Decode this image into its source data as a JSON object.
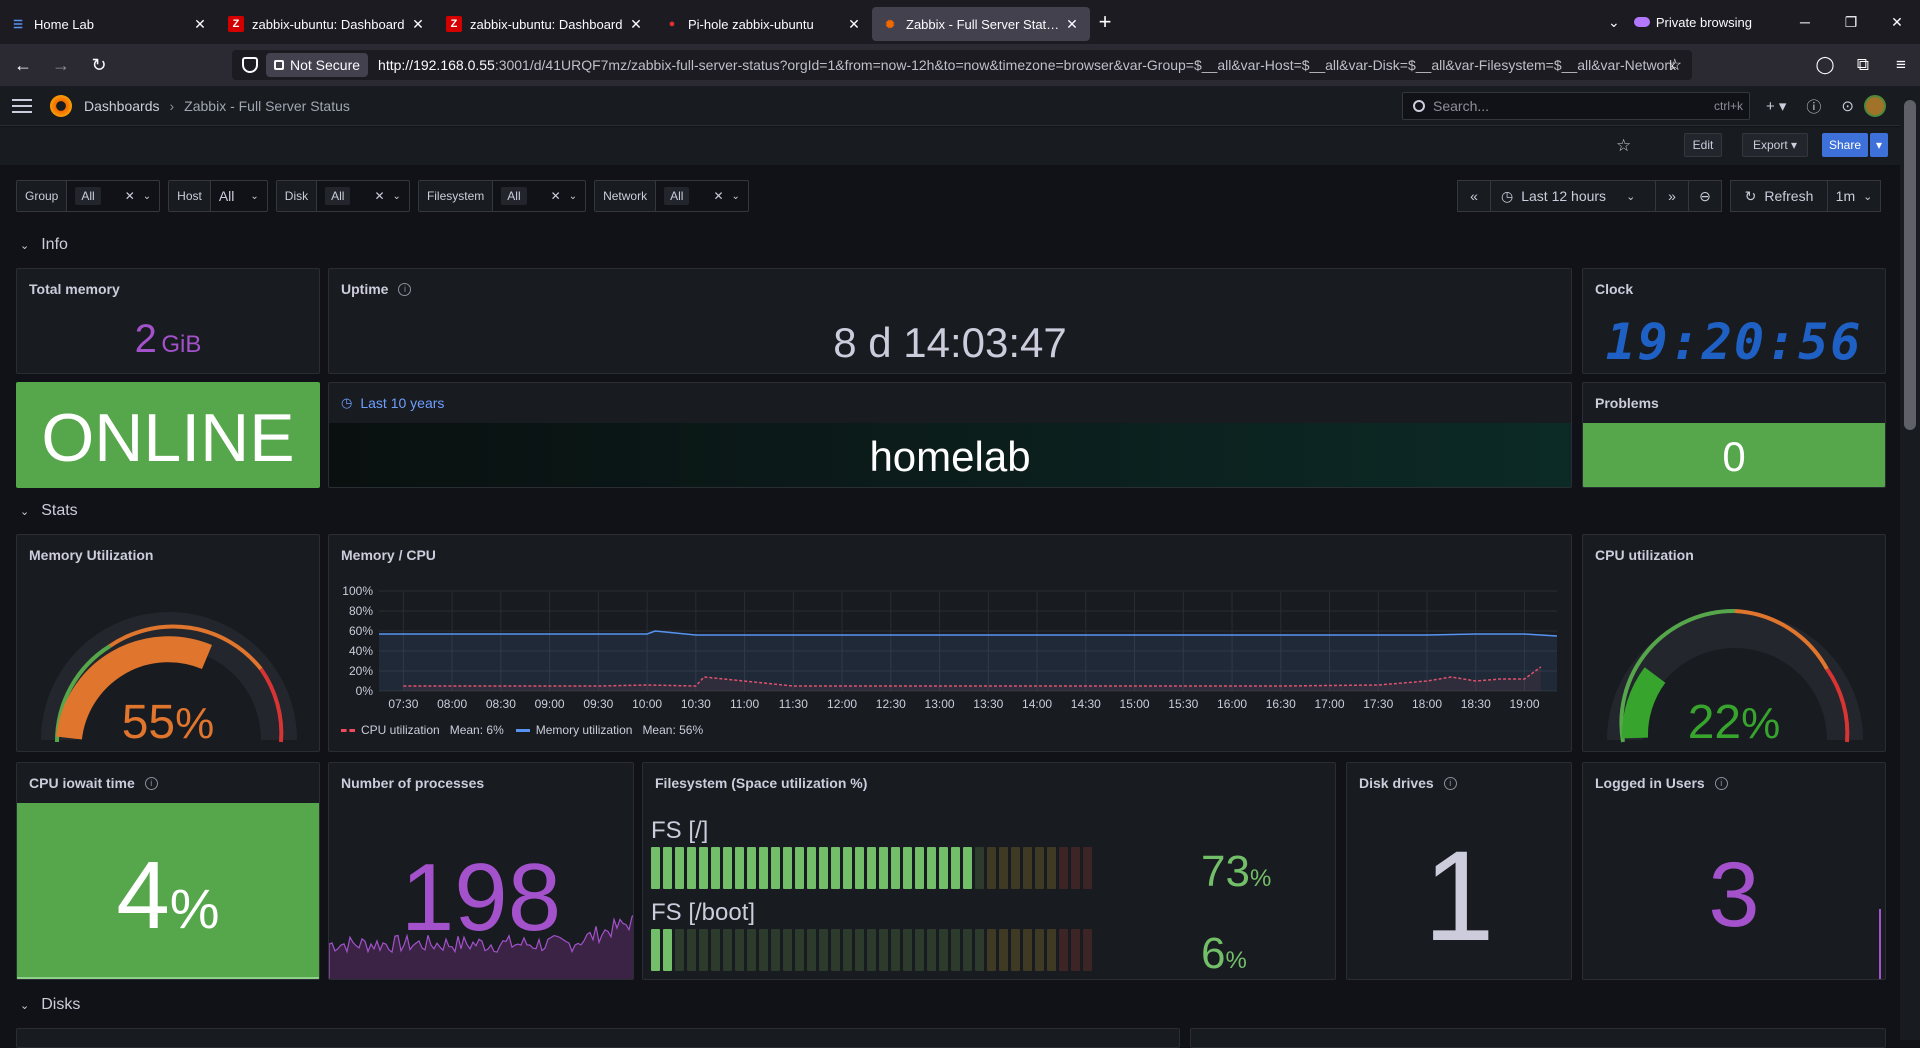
{
  "browser": {
    "tabs": [
      {
        "label": "Home Lab",
        "active": false,
        "icon": "homelab-icon"
      },
      {
        "label": "zabbix-ubuntu: Dashboard",
        "active": false,
        "icon": "zabbix-icon"
      },
      {
        "label": "zabbix-ubuntu: Dashboard",
        "active": false,
        "icon": "zabbix-icon"
      },
      {
        "label": "Pi-hole zabbix-ubuntu",
        "active": false,
        "icon": "pihole-icon"
      },
      {
        "label": "Zabbix - Full Server Status - Das",
        "active": true,
        "icon": "grafana-icon"
      }
    ],
    "private_label": "Private browsing",
    "not_secure": "Not Secure",
    "url_host": "http://192.168.0.55",
    "url_rest": ":3001/d/41URQF7mz/zabbix-full-server-status?orgId=1&from=now-12h&to=now&timezone=browser&var-Group=$__all&var-Host=$__all&var-Disk=$__all&var-Filesystem=$__all&var-Network"
  },
  "grafana": {
    "breadcrumb_root": "Dashboards",
    "breadcrumb_current": "Zabbix - Full Server Status",
    "search_placeholder": "Search...",
    "search_shortcut": "ctrl+k",
    "edit_label": "Edit",
    "export_label": "Export",
    "share_label": "Share",
    "variables": [
      {
        "label": "Group",
        "value": "All",
        "chip": true
      },
      {
        "label": "Host",
        "value": "All",
        "chip": false
      },
      {
        "label": "Disk",
        "value": "All",
        "chip": true
      },
      {
        "label": "Filesystem",
        "value": "All",
        "chip": true
      },
      {
        "label": "Network",
        "value": "All",
        "chip": true
      }
    ],
    "time_range": "Last 12 hours",
    "refresh_label": "Refresh",
    "refresh_interval": "1m"
  },
  "rows": {
    "info": "Info",
    "stats": "Stats",
    "disks": "Disks"
  },
  "panels": {
    "total_memory": {
      "title": "Total memory",
      "value": "2",
      "unit": "GiB"
    },
    "uptime": {
      "title": "Uptime",
      "value": "8 d 14:03:47"
    },
    "clock": {
      "title": "Clock",
      "value": "19:20:56"
    },
    "status": {
      "value": "ONLINE"
    },
    "hostname": {
      "time_override": "Last 10 years",
      "value": "homelab"
    },
    "problems": {
      "title": "Problems",
      "value": "0"
    },
    "memory_util": {
      "title": "Memory Utilization",
      "value": "55",
      "unit": "%"
    },
    "cpu_util": {
      "title": "CPU utilization",
      "value": "22",
      "unit": "%"
    },
    "memcpu": {
      "title": "Memory / CPU",
      "legend_cpu": "CPU utilization",
      "legend_cpu_mean": "Mean: 6%",
      "legend_mem": "Memory utilization",
      "legend_mem_mean": "Mean: 56%"
    },
    "iowait": {
      "title": "CPU iowait time",
      "value": "4",
      "unit": "%"
    },
    "processes": {
      "title": "Number of processes",
      "value": "198"
    },
    "filesystem": {
      "title": "Filesystem (Space utilization %)",
      "items": [
        {
          "name": "FS [/]",
          "value": "73",
          "unit": "%"
        },
        {
          "name": "FS [/boot]",
          "value": "6",
          "unit": "%"
        }
      ]
    },
    "disk_drives": {
      "title": "Disk drives",
      "value": "1"
    },
    "logged_users": {
      "title": "Logged in Users",
      "value": "3"
    }
  },
  "chart_data": {
    "type": "line",
    "title": "Memory / CPU",
    "y_ticks": [
      "100%",
      "80%",
      "60%",
      "40%",
      "20%",
      "0%"
    ],
    "ylim": [
      0,
      100
    ],
    "x_ticks": [
      "07:30",
      "08:00",
      "08:30",
      "09:00",
      "09:30",
      "10:00",
      "10:30",
      "11:00",
      "11:30",
      "12:00",
      "12:30",
      "13:00",
      "13:30",
      "14:00",
      "14:30",
      "15:00",
      "15:30",
      "16:00",
      "16:30",
      "17:00",
      "17:30",
      "18:00",
      "18:30",
      "19:00"
    ],
    "series": [
      {
        "name": "CPU utilization",
        "color": "#f2495c",
        "x": [
          "07:30",
          "08:30",
          "09:30",
          "10:00",
          "10:30",
          "10:35",
          "11:30",
          "12:30",
          "13:30",
          "14:30",
          "15:30",
          "16:30",
          "17:30",
          "18:00",
          "18:15",
          "18:30",
          "18:45",
          "19:00",
          "19:10"
        ],
        "values": [
          5,
          5,
          5,
          6,
          5,
          14,
          5,
          5,
          5,
          5,
          5,
          5,
          6,
          10,
          14,
          10,
          12,
          12,
          24
        ]
      },
      {
        "name": "Memory utilization",
        "color": "#5794f2",
        "x": [
          "07:15",
          "10:00",
          "10:05",
          "10:30",
          "11:30",
          "12:30",
          "13:30",
          "14:30",
          "15:30",
          "16:30",
          "17:30",
          "18:00",
          "18:30",
          "19:00",
          "19:20"
        ],
        "values": [
          57,
          57,
          60,
          56,
          56,
          56,
          56,
          56,
          56,
          56,
          56,
          56,
          57,
          57,
          55
        ]
      }
    ]
  },
  "colors": {
    "green": "#56a64b",
    "purple": "#a352cc",
    "orange": "#e0752d",
    "blue": "#1f60c4",
    "red": "#d83434"
  }
}
